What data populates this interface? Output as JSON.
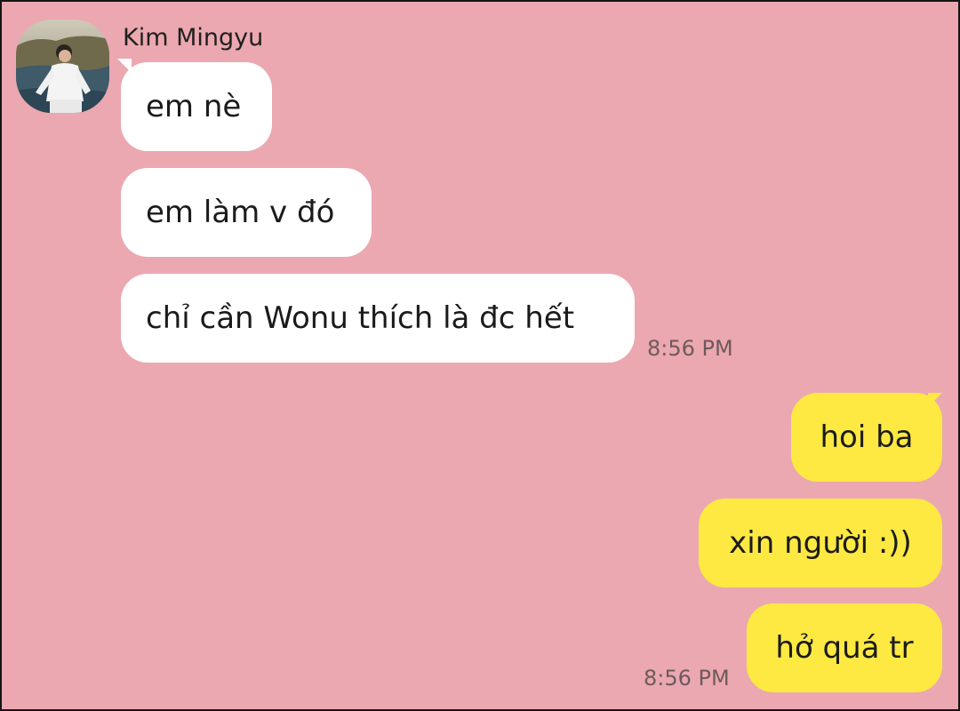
{
  "contact": {
    "name": "Kim Mingyu",
    "avatar_icon": "profile-photo"
  },
  "incoming": [
    {
      "text": "em nè"
    },
    {
      "text": "em làm v đó"
    },
    {
      "text": "chỉ cần Wonu thích là đc hết"
    }
  ],
  "incoming_time": "8:56 PM",
  "outgoing": [
    {
      "text": "hoi ba"
    },
    {
      "text": "xin người :))"
    },
    {
      "text": "hở quá tr"
    }
  ],
  "outgoing_time": "8:56 PM",
  "colors": {
    "background": "#eba8b1",
    "incoming_bubble": "#ffffff",
    "outgoing_bubble": "#fde942",
    "timestamp": "#6e5a5c"
  }
}
